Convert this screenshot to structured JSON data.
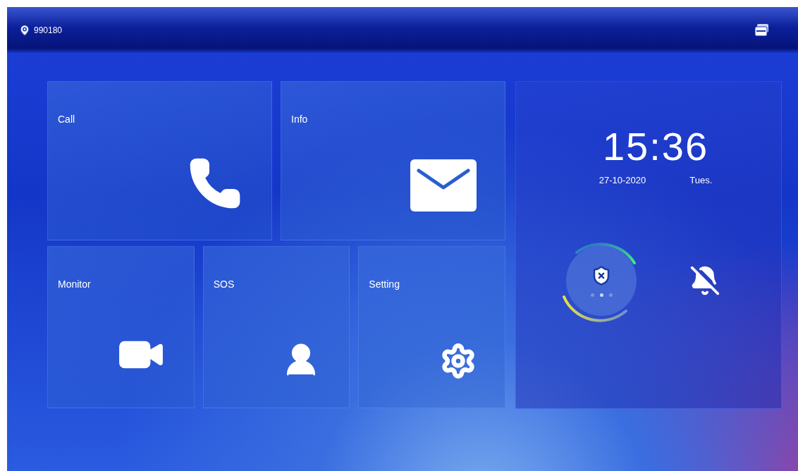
{
  "header": {
    "location": "990180"
  },
  "tile_rows": [
    [
      {
        "label": "Call",
        "kind": "phone"
      },
      {
        "label": "Info",
        "kind": "mail"
      }
    ],
    [
      {
        "label": "Monitor",
        "kind": "camera"
      },
      {
        "label": "SOS",
        "kind": "guard"
      },
      {
        "label": "Setting",
        "kind": "gear"
      }
    ]
  ],
  "clock": {
    "time": "15:36",
    "date": "27-10-2020",
    "weekday": "Tues."
  },
  "pager": [
    {
      "selected": false
    },
    {
      "selected": true
    },
    {
      "selected": false
    }
  ]
}
